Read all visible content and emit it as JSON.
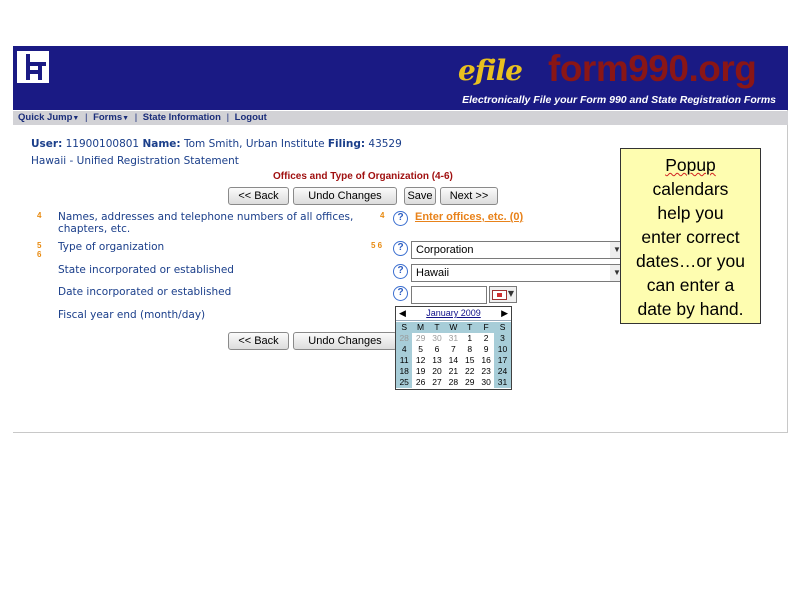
{
  "header": {
    "efile_text": "efile",
    "brand": "form990.org",
    "tagline": "Electronically File your Form 990 and State Registration Forms"
  },
  "menu": {
    "quick_jump": "Quick Jump",
    "forms": "Forms",
    "state_info": "State Information",
    "logout": "Logout"
  },
  "info": {
    "user_label": "User:",
    "user_id": "11900100801",
    "name_label": "Name:",
    "name": "Tom Smith, Urban Institute",
    "filing_label": "Filing:",
    "filing": "43529",
    "statement": "Hawaii - Unified Registration Statement"
  },
  "section_title": "Offices and Type of Organization (4-6)",
  "buttons": {
    "back": "<< Back",
    "undo": "Undo Changes",
    "save": "Save",
    "next": "Next >>"
  },
  "fields": {
    "offices": {
      "num": "4",
      "line_num": "4",
      "label_line1": "Names, addresses and telephone numbers of all offices,",
      "label_line2": "chapters, etc.",
      "link": "Enter offices, etc. (0)"
    },
    "org_type": {
      "num_a": "5",
      "num_b": "6",
      "line_num": "5 6",
      "label": "Type of organization",
      "value": "Corporation"
    },
    "state": {
      "label": "State incorporated or established",
      "value": "Hawaii"
    },
    "date": {
      "label": "Date incorporated or established",
      "value": ""
    },
    "fiscal": {
      "label": "Fiscal year end (month/day)"
    }
  },
  "help_glyph": "?",
  "calendar": {
    "prev": "◀",
    "next": "▶",
    "month": "January 2009",
    "days_of_week": [
      "S",
      "M",
      "T",
      "W",
      "T",
      "F",
      "S"
    ],
    "weeks": [
      [
        "28",
        "29",
        "30",
        "31",
        "1",
        "2",
        "3"
      ],
      [
        "4",
        "5",
        "6",
        "7",
        "8",
        "9",
        "10"
      ],
      [
        "11",
        "12",
        "13",
        "14",
        "15",
        "16",
        "17"
      ],
      [
        "18",
        "19",
        "20",
        "21",
        "22",
        "23",
        "24"
      ],
      [
        "25",
        "26",
        "27",
        "28",
        "29",
        "30",
        "31"
      ]
    ],
    "first_week_other_month_count": 4
  },
  "callout": {
    "lines": [
      "Popup",
      "calendars",
      "help you",
      "enter correct",
      "dates…or you",
      "can enter a",
      "date by hand."
    ]
  },
  "colors": {
    "header_bg": "#1a1a84",
    "brand": "#8a1616",
    "efile": "#e8c020",
    "link_text": "#1a3e8a",
    "section_title": "#a01010",
    "orange_link": "#e8821a",
    "callout_bg": "#fefdb0"
  }
}
